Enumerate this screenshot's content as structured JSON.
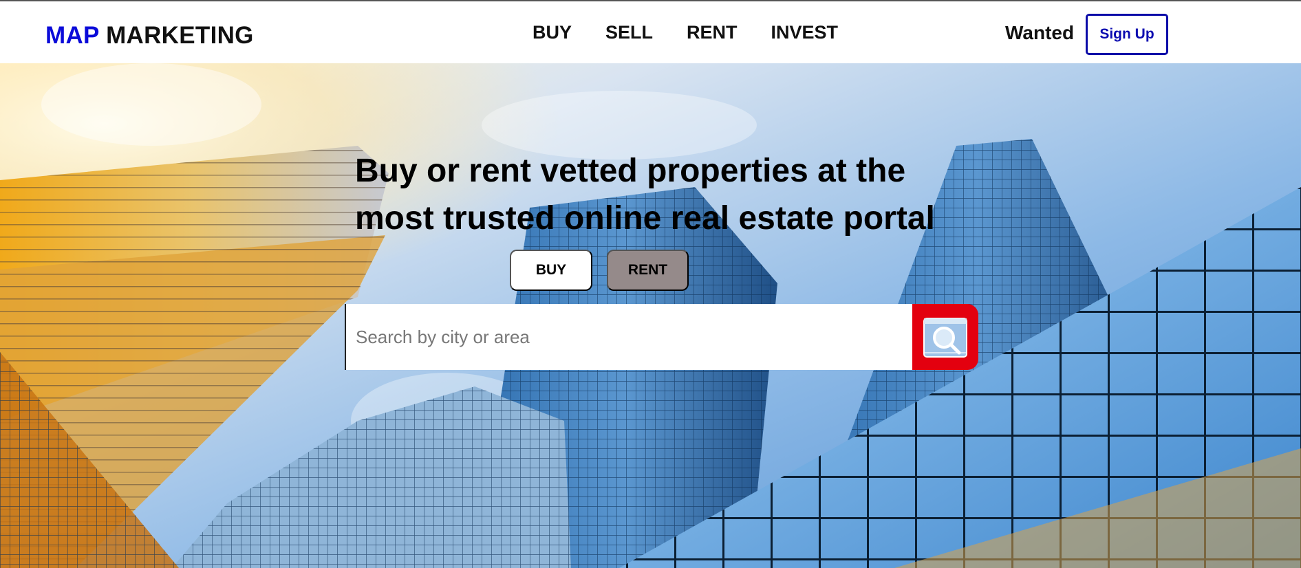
{
  "brand": {
    "part1": "MAP",
    "part2": "MARKETING"
  },
  "nav": {
    "links": [
      "BUY",
      "SELL",
      "RENT",
      "INVEST"
    ]
  },
  "header": {
    "wanted": "Wanted",
    "signup": "Sign Up"
  },
  "hero": {
    "headline_line1": "Buy or rent vetted properties at the",
    "headline_line2": "most trusted online real estate portal",
    "toggle_buy": "BUY",
    "toggle_rent": "RENT",
    "search_placeholder": "Search by city or area",
    "search_icon": "magnifier-icon"
  },
  "colors": {
    "brand_blue": "#0b0bd9",
    "signup_border": "#0c0ca8",
    "search_button": "#e3000f",
    "rent_toggle": "#958a8a"
  }
}
